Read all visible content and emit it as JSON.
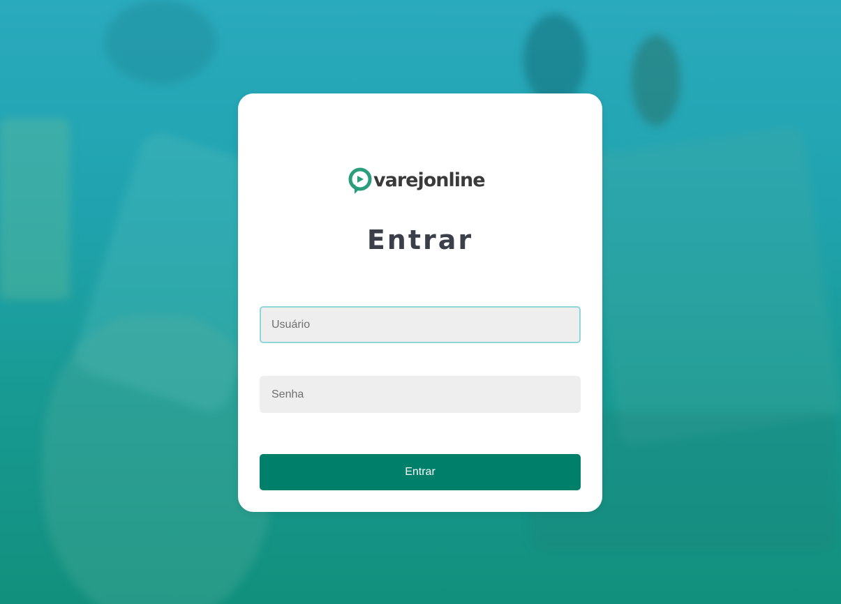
{
  "brand": {
    "logo_text": "varejonline",
    "logo_icon": "varejonline-pin-logo-icon",
    "colors": {
      "primary": "#007f6b",
      "logo_green": "#2a9d7c",
      "focus_border": "#8fd6d8",
      "background_top": "#2aaabd",
      "background_bottom": "#12907d"
    }
  },
  "login": {
    "title": "Entrar",
    "username": {
      "value": "",
      "placeholder": "Usuário",
      "focused": true
    },
    "password": {
      "value": "",
      "placeholder": "Senha"
    },
    "submit_label": "Entrar"
  }
}
